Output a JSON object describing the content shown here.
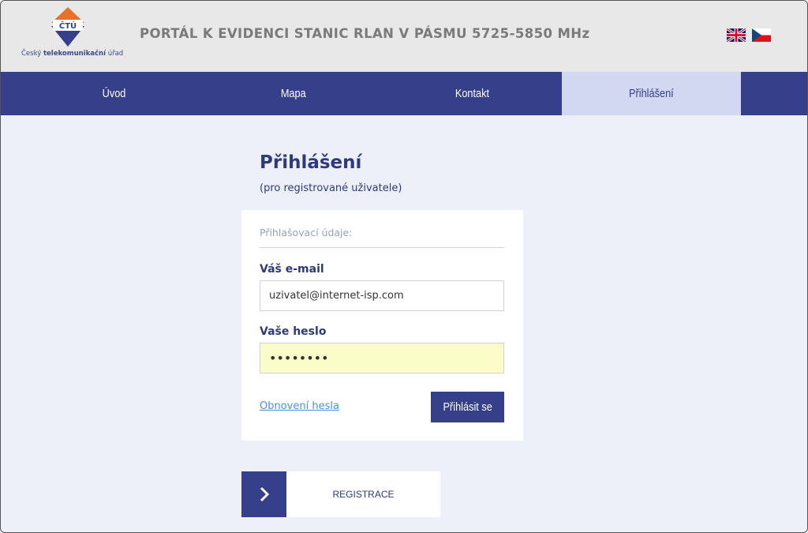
{
  "header": {
    "logo_label": "ČTÚ",
    "logo_org_prefix": "Český ",
    "logo_org_bold": "telekomunikační",
    "logo_org_suffix": " úřad",
    "title": "PORTÁL K EVIDENCI STANIC RLAN V PÁSMU 5725-5850 MHz",
    "languages": [
      {
        "code": "en",
        "icon": "uk-flag-icon"
      },
      {
        "code": "cs",
        "icon": "czech-flag-icon"
      }
    ]
  },
  "nav": {
    "items": [
      {
        "label": "Úvod",
        "active": false
      },
      {
        "label": "Mapa",
        "active": false
      },
      {
        "label": "Kontakt",
        "active": false
      },
      {
        "label": "Přihlášení",
        "active": true
      }
    ]
  },
  "login": {
    "heading": "Přihlášení",
    "subheading": "(pro registrované uživatele)",
    "legend": "Přihlašovací údaje:",
    "email_label": "Váš e-mail",
    "email_value": "uzivatel@internet-isp.com",
    "password_label": "Vaše heslo",
    "password_value": "xxxxxxxx",
    "forgot_link": "Obnovení hesla",
    "submit_label": "Přihlásit se"
  },
  "register": {
    "label": "REGISTRACE",
    "icon": "chevron-right-icon"
  },
  "colors": {
    "primary": "#353f8a",
    "active_tab": "#d3d8f2",
    "background": "#eef0f9",
    "header_bg": "#e8e8e8",
    "logo_orange": "#e8702a",
    "autofill": "#fafdc8",
    "link": "#4a90e2"
  }
}
